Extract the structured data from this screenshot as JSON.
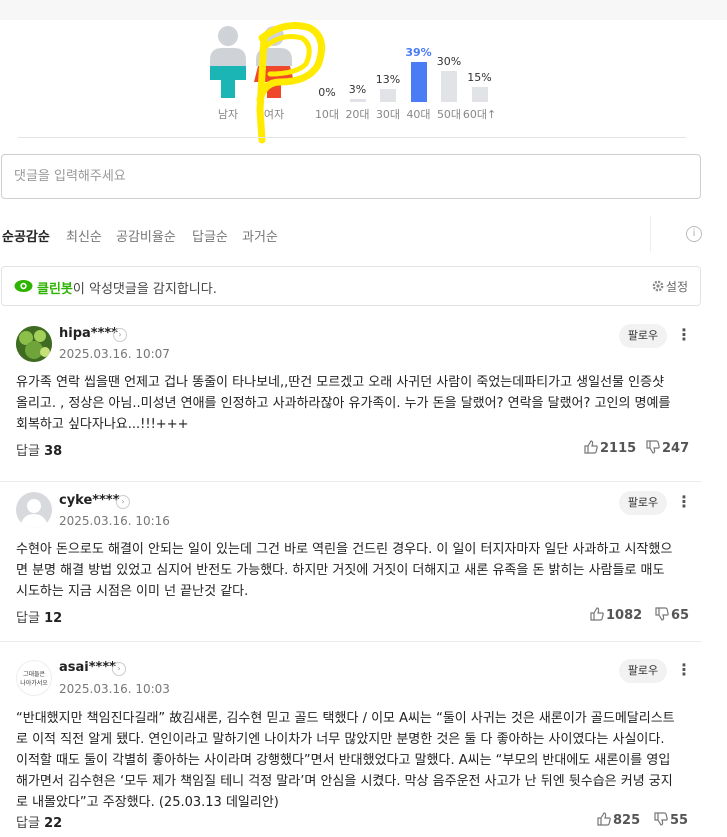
{
  "gender_stats": [
    {
      "label": "남자",
      "color": "#1bb5b5"
    },
    {
      "label": "여자",
      "color": "#f0492a"
    }
  ],
  "age_stats": [
    {
      "label": "10대",
      "pct": "0%",
      "value": 0
    },
    {
      "label": "20대",
      "pct": "3%",
      "value": 3
    },
    {
      "label": "30대",
      "pct": "13%",
      "value": 13
    },
    {
      "label": "40대",
      "pct": "39%",
      "value": 39,
      "highlight": true
    },
    {
      "label": "50대",
      "pct": "30%",
      "value": 30
    },
    {
      "label": "60대↑",
      "pct": "15%",
      "value": 15
    }
  ],
  "comment_input": {
    "placeholder": "댓글을 입력해주세요"
  },
  "sort_tabs": [
    "순공감순",
    "최신순",
    "공감비율순",
    "답글순",
    "과거순"
  ],
  "cleanbot": {
    "name": "클린봇",
    "text": "이 악성댓글을 감지합니다.",
    "settings": "설정"
  },
  "comments": [
    {
      "username": "hipa****",
      "date": "2025.03.16. 10:07",
      "follow": "팔로우",
      "text": "유가족 연락 씹을땐 언제고 겁나 똥줄이 타나보네,,딴건 모르겠고 오래 사귀던 사람이 죽었는데파티가고 생일선물 인증샷 올리고. , 정상은 아님..미성년 연애를 인정하고 사과하라잖아 유가족이. 누가 돈을 달랬어? 연락을 달랬어? 고인의 명예를 회복하고 싶다자나요...!!!+++",
      "reply_label": "답글",
      "reply_count": "38",
      "likes": "2115",
      "dislikes": "247"
    },
    {
      "username": "cyke****",
      "date": "2025.03.16. 10:16",
      "follow": "팔로우",
      "text": "수현아 돈으로도 해결이 안되는 일이 있는데 그건 바로 역린을 건드린 경우다. 이 일이 터지자마자 일단 사과하고 시작했으면 분명 해결 방법 있었고 심지어 반전도 가능했다. 하지만 거짓에 거짓이 더해지고 새론 유족을 돈 밝히는 사람들로 매도 시도하는 지금 시점은 이미 넌 끝난것 같다.",
      "reply_label": "답글",
      "reply_count": "12",
      "likes": "1082",
      "dislikes": "65"
    },
    {
      "username": "asai****",
      "date": "2025.03.16. 10:03",
      "follow": "팔로우",
      "avatar_text": [
        "그대들은",
        "나아가서오"
      ],
      "text": "“반대했지만 책임진다길래” 故김새론, 김수현 믿고 골드 택했다 / 이모 A씨는 “둘이 사귀는 것은 새론이가 골드메달리스트로 이적 직전 알게 됐다. 연인이라고 말하기엔 나이차가 너무 많았지만 분명한 것은 둘 다 좋아하는 사이였다는 사실이다. 이적할 때도 둘이 각별히 좋아하는 사이라며 강행했다”면서 반대했었다고 말했다. A씨는 “부모의 반대에도 새론이를 영입해가면서 김수현은 ‘모두 제가 책임질 테니 걱정 말라’며 안심을 시켰다. 막상 음주운전 사고가 난 뒤엔 뒷수습은 커녕 궁지로 내몰았다”고 주장했다. (25.03.13 데일리안)",
      "reply_label": "답글",
      "reply_count": "22",
      "likes": "825",
      "dislikes": "55"
    }
  ]
}
